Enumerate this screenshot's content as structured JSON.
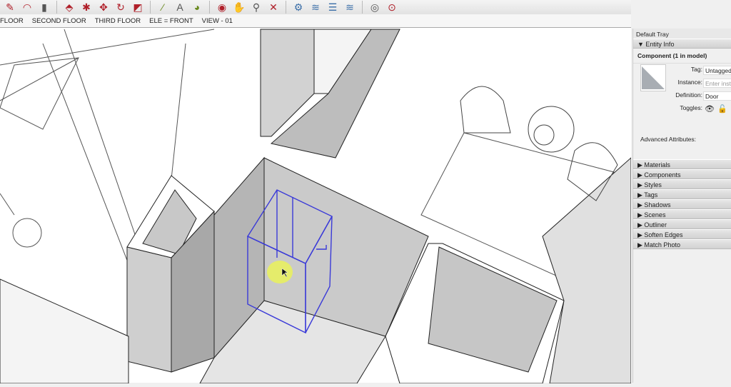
{
  "toolbar": {
    "icons": [
      "pencil-icon",
      "arc-icon",
      "shape-icon",
      "push-pull-icon",
      "follow-me-icon",
      "move-icon",
      "rotate-icon",
      "scale-icon",
      "tape-measure-icon",
      "text-icon",
      "paint-bucket-icon",
      "orbit-icon",
      "pan-icon",
      "zoom-icon",
      "zoom-extents-icon",
      "extension-icon-1",
      "extension-icon-2",
      "extension-icon-3",
      "extension-icon-4",
      "user-icon",
      "warehouse-icon"
    ]
  },
  "scenes": [
    "FLOOR",
    "SECOND FLOOR",
    "THIRD FLOOR",
    "ELE = FRONT",
    "VIEW - 01"
  ],
  "tray": {
    "title": "Default Tray",
    "entity_info": {
      "header": "Entity Info",
      "component": "Component (1 in model)",
      "tag_label": "Tag:",
      "tag_value": "Untagged",
      "instance_label": "Instance:",
      "instance_placeholder": "Enter instance name",
      "definition_label": "Definition:",
      "definition_value": "Door",
      "toggles_label": "Toggles:",
      "advanced": "Advanced Attributes:"
    },
    "panels": [
      "Materials",
      "Components",
      "Styles",
      "Tags",
      "Shadows",
      "Scenes",
      "Outliner",
      "Soften Edges",
      "Match Photo"
    ]
  },
  "colors": {
    "selection": "#3a3ad8",
    "highlight": "#e8f060",
    "wall": "#c8c8c8"
  }
}
